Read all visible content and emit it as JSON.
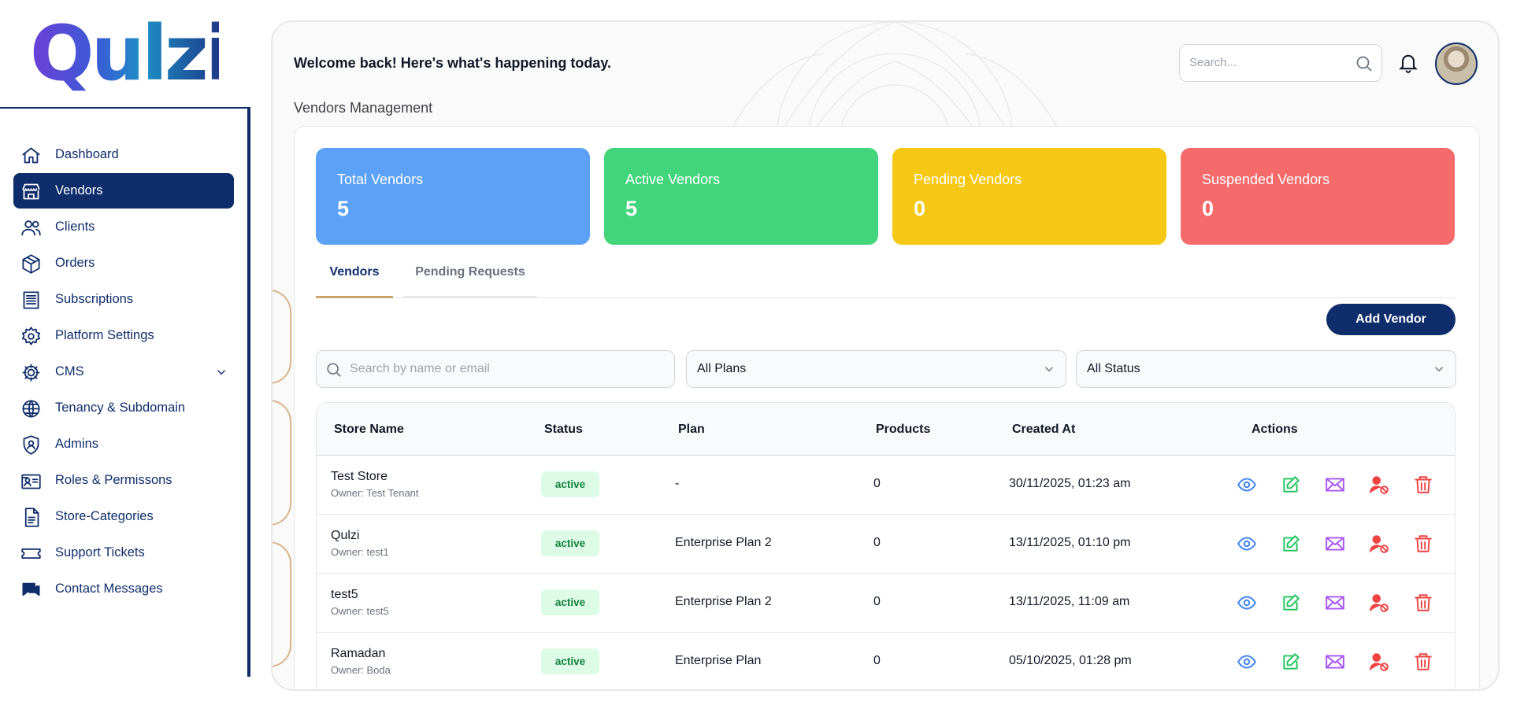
{
  "brand": {
    "logo_text": "Qulzi"
  },
  "sidebar": {
    "items": [
      {
        "label": "Dashboard",
        "icon": "home-icon"
      },
      {
        "label": "Vendors",
        "icon": "store-icon",
        "active": true
      },
      {
        "label": "Clients",
        "icon": "users-icon"
      },
      {
        "label": "Orders",
        "icon": "box-icon"
      },
      {
        "label": "Subscriptions",
        "icon": "receipt-icon"
      },
      {
        "label": "Platform Settings",
        "icon": "gear-icon"
      },
      {
        "label": "CMS",
        "icon": "cog-icon",
        "expandable": true
      },
      {
        "label": "Tenancy & Subdomain",
        "icon": "globe-icon"
      },
      {
        "label": "Admins",
        "icon": "shield-user-icon"
      },
      {
        "label": "Roles & Permissons",
        "icon": "id-card-icon"
      },
      {
        "label": "Store-Categories",
        "icon": "document-icon"
      },
      {
        "label": "Support Tickets",
        "icon": "ticket-icon"
      },
      {
        "label": "Contact Messages",
        "icon": "chat-icon"
      }
    ]
  },
  "header": {
    "welcome": "Welcome back! Here's what's happening today.",
    "search_placeholder": "Search...",
    "section_title": "Vendors Management"
  },
  "stats": [
    {
      "title": "Total Vendors",
      "value": "5",
      "color": "#5ba1f7"
    },
    {
      "title": "Active Vendors",
      "value": "5",
      "color": "#42d57b"
    },
    {
      "title": "Pending Vendors",
      "value": "0",
      "color": "#f5c816"
    },
    {
      "title": "Suspended Vendors",
      "value": "0",
      "color": "#f56b6b"
    }
  ],
  "tabs": [
    {
      "label": "Vendors",
      "active": true
    },
    {
      "label": "Pending Requests"
    }
  ],
  "add_button": "Add Vendor",
  "filters": {
    "search_placeholder": "Search by name or email",
    "plan_value": "All Plans",
    "status_value": "All Status"
  },
  "table": {
    "columns": [
      "Store Name",
      "Status",
      "Plan",
      "Products",
      "Created At",
      "Actions"
    ],
    "rows": [
      {
        "store": "Test Store",
        "owner": "Owner: Test Tenant",
        "status": "active",
        "plan": "-",
        "products": "0",
        "created": "30/11/2025, 01:23 am"
      },
      {
        "store": "Qulzi",
        "owner": "Owner: test1",
        "status": "active",
        "plan": "Enterprise Plan 2",
        "products": "0",
        "created": "13/11/2025, 01:10 pm"
      },
      {
        "store": "test5",
        "owner": "Owner: test5",
        "status": "active",
        "plan": "Enterprise Plan 2",
        "products": "0",
        "created": "13/11/2025, 11:09 am"
      },
      {
        "store": "Ramadan",
        "owner": "Owner: Boda",
        "status": "active",
        "plan": "Enterprise Plan",
        "products": "0",
        "created": "05/10/2025, 01:28 pm"
      }
    ]
  },
  "colors": {
    "primary": "#0f2d6b",
    "tab_underline": "#c9a56a",
    "view": "#3b82f6",
    "edit": "#22c55e",
    "mail": "#a855f7",
    "suspend": "#ef4444",
    "delete": "#ef4444"
  }
}
